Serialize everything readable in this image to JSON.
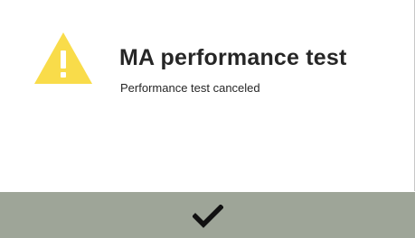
{
  "dialog": {
    "title": "MA performance test",
    "message": "Performance test canceled",
    "icon": "warning-icon",
    "confirm_icon": "checkmark-icon"
  },
  "colors": {
    "warning": "#f9dc4a",
    "footer": "#9ea598",
    "text": "#262626"
  }
}
